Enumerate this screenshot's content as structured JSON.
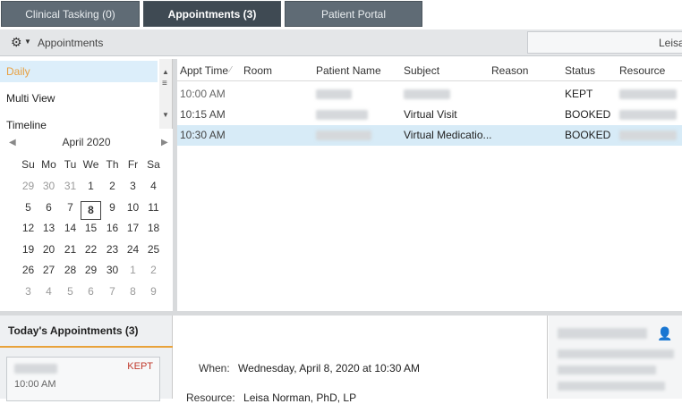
{
  "tabs": [
    {
      "label": "Clinical Tasking (0)",
      "active": false
    },
    {
      "label": "Appointments (3)",
      "active": true
    },
    {
      "label": "Patient Portal",
      "active": false
    }
  ],
  "toolbar": {
    "gear_icon": "gear-icon",
    "title": "Appointments",
    "user": "Leisa"
  },
  "views": [
    {
      "label": "Daily",
      "selected": true
    },
    {
      "label": "Multi View",
      "selected": false
    },
    {
      "label": "Timeline",
      "selected": false
    }
  ],
  "calendar": {
    "month": "April 2020",
    "prev_icon": "chevron-left-icon",
    "next_icon": "chevron-right-icon",
    "dow": [
      "Su",
      "Mo",
      "Tu",
      "We",
      "Th",
      "Fr",
      "Sa"
    ],
    "weeks": [
      [
        "29",
        "30",
        "31",
        "1",
        "2",
        "3",
        "4"
      ],
      [
        "5",
        "6",
        "7",
        "8",
        "9",
        "10",
        "11"
      ],
      [
        "12",
        "13",
        "14",
        "15",
        "16",
        "17",
        "18"
      ],
      [
        "19",
        "20",
        "21",
        "22",
        "23",
        "24",
        "25"
      ],
      [
        "26",
        "27",
        "28",
        "29",
        "30",
        "1",
        "2"
      ],
      [
        "3",
        "4",
        "5",
        "6",
        "7",
        "8",
        "9"
      ]
    ],
    "today": "8"
  },
  "grid": {
    "headers": [
      "Appt Time",
      "Room",
      "Patient Name",
      "Subject",
      "Reason",
      "Status",
      "Resource"
    ],
    "rows": [
      {
        "time": "10:00 AM",
        "subject": "",
        "status": "KEPT",
        "selected": false
      },
      {
        "time": "10:15 AM",
        "subject": "Virtual Visit",
        "status": "BOOKED",
        "selected": false
      },
      {
        "time": "10:30 AM",
        "subject": "Virtual  Medicatio...",
        "status": "BOOKED",
        "selected": true
      }
    ]
  },
  "today_panel": {
    "title": "Today's Appointments (3)",
    "card": {
      "status": "KEPT",
      "time": "10:00 AM"
    }
  },
  "detail": {
    "when_label": "When:",
    "when_value": "Wednesday, April 8, 2020 at 10:30 AM",
    "resource_label": "Resource:",
    "resource_value": "Leisa Norman, PhD, LP"
  },
  "colors": {
    "tab_bg": "#5f6b75",
    "tab_active_bg": "#3f4a53",
    "selected_row": "#d7ebf7",
    "accent": "#e8a23a",
    "kept": "#c0392b"
  }
}
